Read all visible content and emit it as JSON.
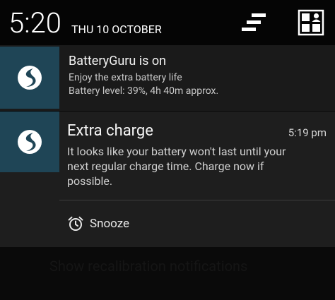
{
  "status": {
    "time": "5:20",
    "date": "THU 10 OCTOBER",
    "clear_icon": "clear-all-icon",
    "settings_icon": "quick-settings-icon"
  },
  "notifications": [
    {
      "app_icon": "batteryguru-logo-icon",
      "title": "BatteryGuru is on",
      "line1": "Enjoy the extra battery life",
      "line2": "Battery level: 39%, 4h 40m approx."
    },
    {
      "app_icon": "batteryguru-logo-icon",
      "title": "Extra charge",
      "time": "5:19 pm",
      "body": "It looks like your battery won't last until your next regular charge time. Charge now if possible.",
      "action": {
        "icon": "alarm-clock-icon",
        "label": "Snooze"
      }
    }
  ],
  "background": {
    "ghost_text": "Show recalibration notifications"
  },
  "colors": {
    "icon_bg": "#1f4556",
    "card_bg": "#1e1e1e"
  }
}
